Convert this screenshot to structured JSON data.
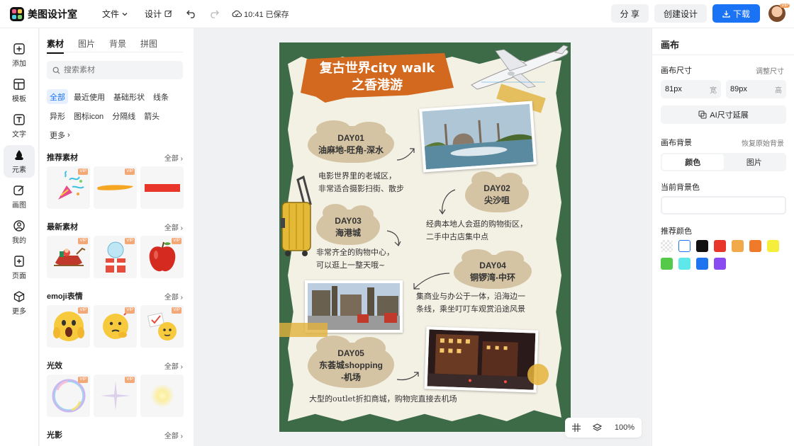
{
  "app": {
    "name": "美图设计室"
  },
  "menu": {
    "file": "文件",
    "design": "设计",
    "save_status": "10:41 已保存"
  },
  "actions": {
    "share": "分 享",
    "create": "创建设计",
    "download": "下载",
    "avatar_badge": "VIP"
  },
  "rail": [
    {
      "label": "添加",
      "icon": "plus-square-icon"
    },
    {
      "label": "模板",
      "icon": "template-icon"
    },
    {
      "label": "文字",
      "icon": "text-icon"
    },
    {
      "label": "元素",
      "icon": "shapes-icon",
      "active": true
    },
    {
      "label": "画图",
      "icon": "pen-icon"
    },
    {
      "label": "我的",
      "icon": "user-icon"
    },
    {
      "label": "页面",
      "icon": "page-add-icon"
    },
    {
      "label": "更多",
      "icon": "cube-icon"
    }
  ],
  "panel": {
    "tabs": [
      "素材",
      "图片",
      "背景",
      "拼图"
    ],
    "search_placeholder": "搜索素材",
    "chips": [
      "全部",
      "最近使用",
      "基础形状",
      "线条",
      "异形",
      "图标icon",
      "分隔线",
      "箭头",
      "更多"
    ],
    "vip": "VIP",
    "all_label": "全部",
    "sections": [
      "推荐素材",
      "最新素材",
      "emoji表情",
      "光效",
      "光影"
    ]
  },
  "poster": {
    "title_line1": "复古世界city walk",
    "title_line2": "之香港游",
    "day1_title": "DAY01",
    "day1_place": "油麻地-旺角-深水",
    "day1_desc1": "电影世界里的老城区，",
    "day1_desc2": "非常适合摄影扫街、散步",
    "day2_title": "DAY02",
    "day2_place": "尖沙咀",
    "day2_desc1": "经典本地人会逛的购物街区，",
    "day2_desc2": "二手中古店集中点",
    "day3_title": "DAY03",
    "day3_place": "海港城",
    "day3_desc1": "非常齐全的购物中心，",
    "day3_desc2": "可以逛上一整天哦~",
    "day4_title": "DAY04",
    "day4_place": "铜锣湾-中环",
    "day4_desc1": "集商业与办公于一体，沿海边一",
    "day4_desc2": "条线，乘坐叮叮车观赏沿途风景",
    "day5_title": "DAY05",
    "day5_place1": "东荟城shopping",
    "day5_place2": "-机场",
    "day5_desc": "大型的outlet折扣商城，购物完直接去机场"
  },
  "zoom": {
    "level": "100%"
  },
  "right": {
    "title": "画布",
    "size_label": "画布尺寸",
    "resize_link": "调整尺寸",
    "width_value": "81px",
    "width_unit": "宽",
    "height_value": "89px",
    "height_unit": "高",
    "ai_extend": "AI尺寸延展",
    "bg_label": "画布背景",
    "restore_link": "恢复原始背景",
    "seg_color": "颜色",
    "seg_image": "图片",
    "current_bg": "当前背景色",
    "recommended": "推荐颜色",
    "swatches": [
      "transparent",
      "#ffffff",
      "#111111",
      "#e8362b",
      "#f2a94a",
      "#ef7a2a",
      "#f5ef3c",
      "#54c94a",
      "#5fe8ea",
      "#1f74ef",
      "#8a4cf0"
    ]
  }
}
